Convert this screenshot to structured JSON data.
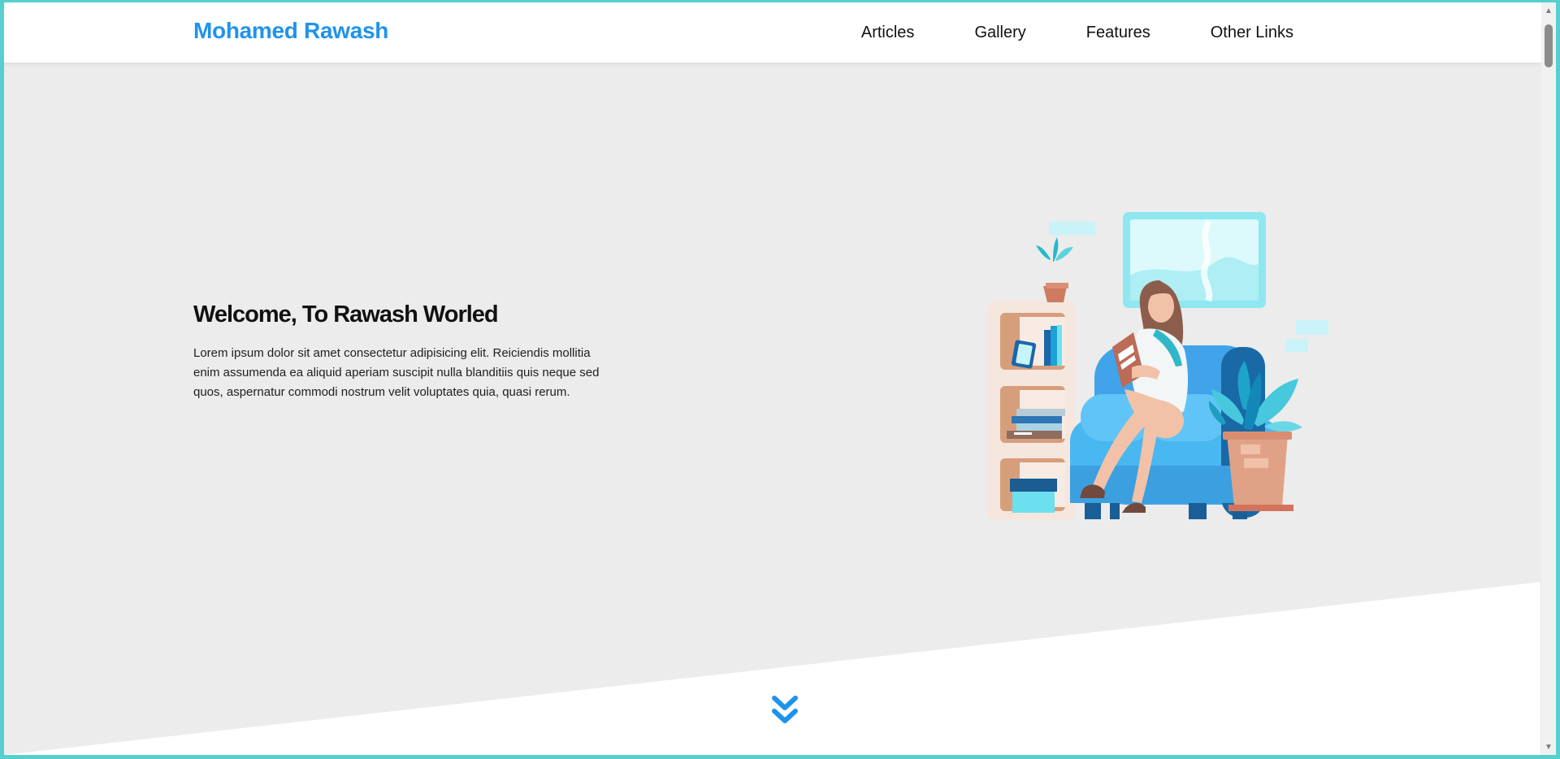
{
  "header": {
    "logo": "Mohamed Rawash",
    "nav": [
      {
        "label": "Articles"
      },
      {
        "label": "Gallery"
      },
      {
        "label": "Features"
      },
      {
        "label": "Other Links"
      }
    ]
  },
  "hero": {
    "title": "Welcome, To Rawash Worled",
    "text": "Lorem ipsum dolor sit amet consectetur adipisicing elit. Reiciendis mollitia enim assumenda ea aliquid aperiam suscipit nulla blanditiis quis neque sed quos, aspernatur commodi nostrum velit voluptates quia, quasi rerum."
  },
  "icons": {
    "scroll_down": "double-chevron-down-icon",
    "scroll_up_arrow": "triangle-up-icon",
    "scroll_down_arrow": "triangle-down-icon"
  },
  "colors": {
    "brand": "#1f93ec",
    "hero_bg": "#ececec",
    "outer_frame": "#57cfcf"
  }
}
